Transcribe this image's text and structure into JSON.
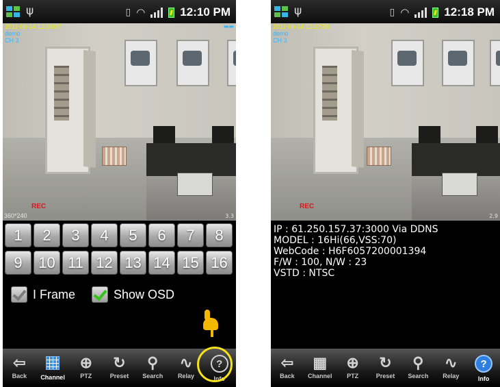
{
  "left_phone": {
    "status": {
      "time": "12:10 PM"
    },
    "camera": {
      "timestamp": "2011-06-14 12:10:07",
      "site": "demo",
      "channel": "CH 3",
      "rec": "REC",
      "resolution": "360*240",
      "corner": "3.3"
    },
    "channels": [
      "1",
      "2",
      "3",
      "4",
      "5",
      "6",
      "7",
      "8",
      "9",
      "10",
      "11",
      "12",
      "13",
      "14",
      "15",
      "16"
    ],
    "options": {
      "iframe": {
        "label": "I Frame",
        "checked": false
      },
      "show_osd": {
        "label": "Show OSD",
        "checked": true
      }
    }
  },
  "right_phone": {
    "status": {
      "time": "12:18 PM"
    },
    "camera": {
      "timestamp": "2011-06-14 12:17:56",
      "site": "demo",
      "channel": "CH 3",
      "rec": "REC",
      "corner": "2.9"
    },
    "info_lines": [
      "IP : 61.250.157.37:3000 Via DDNS",
      "MODEL : 16Hi(66,VSS:70)",
      "WebCode : H6F6057200001394",
      "F/W : 100, N/W : 23",
      "VSTD : NTSC"
    ]
  },
  "toolbar": [
    {
      "label": "Back",
      "icon": "back-arrow-icon"
    },
    {
      "label": "Channel",
      "icon": "channel-grid-icon"
    },
    {
      "label": "PTZ",
      "icon": "ptz-icon"
    },
    {
      "label": "Preset",
      "icon": "preset-icon"
    },
    {
      "label": "Search",
      "icon": "search-icon"
    },
    {
      "label": "Relay",
      "icon": "relay-icon"
    },
    {
      "label": "Info",
      "icon": "info-icon"
    }
  ],
  "colors": {
    "accent_blue": "#2f7fe0",
    "highlight_yellow": "#f5e21a",
    "rec_red": "#e0141a",
    "check_green": "#33c41b"
  }
}
